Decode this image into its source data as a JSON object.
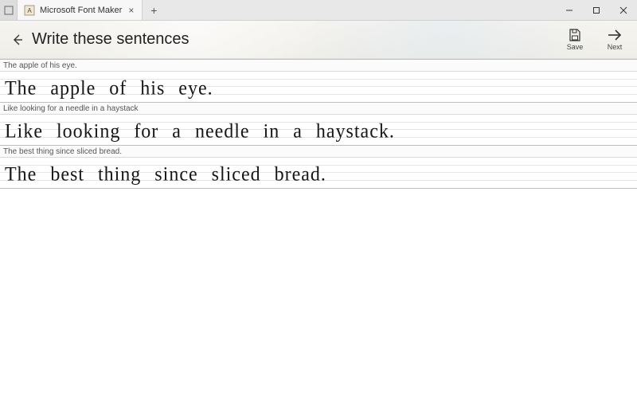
{
  "window": {
    "tab_title": "Microsoft Font Maker",
    "new_tab_glyph": "+",
    "close_glyph": "×",
    "minimize_glyph": "—",
    "maximize_glyph": "□",
    "win_close_glyph": "×"
  },
  "header": {
    "back_glyph": "←",
    "title": "Write these sentences",
    "save_label": "Save",
    "next_label": "Next",
    "next_glyph": "→"
  },
  "sentences": [
    {
      "prompt": "The apple of his eye.",
      "written": "The apple of his eye."
    },
    {
      "prompt": "Like looking for a needle in a haystack",
      "written": "Like looking for a needle in a haystack."
    },
    {
      "prompt": "The best thing since sliced bread.",
      "written": "The best thing since sliced bread."
    }
  ]
}
